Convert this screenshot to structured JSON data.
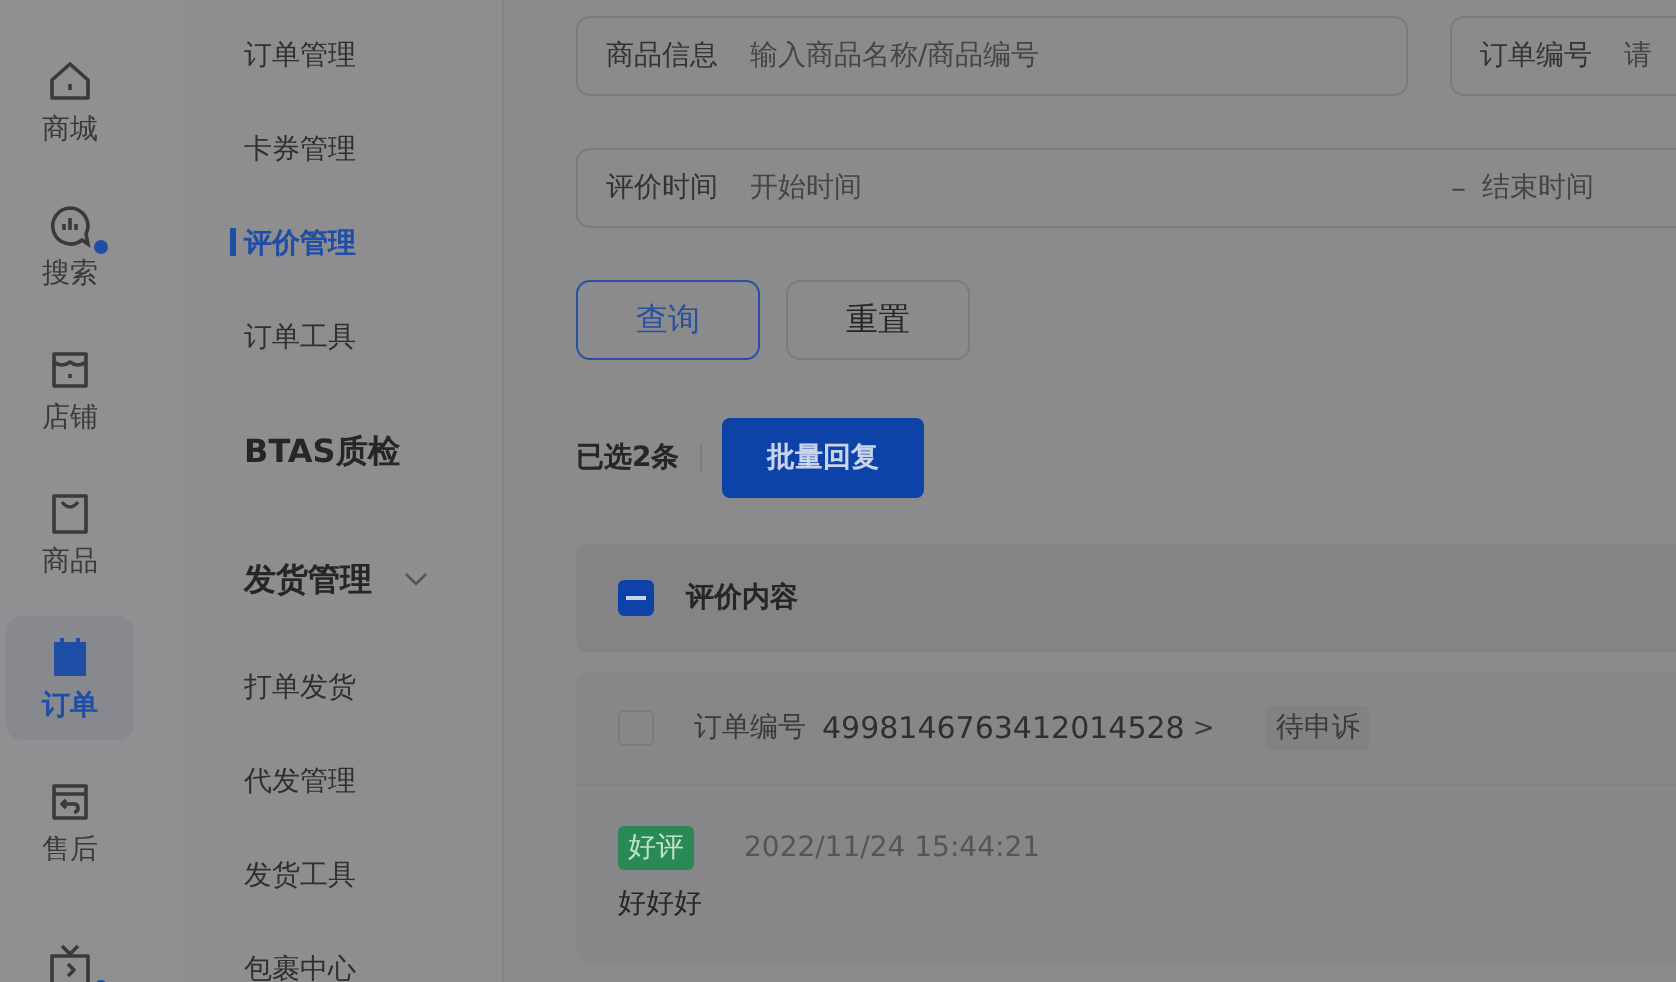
{
  "nav": [
    {
      "label": "商城",
      "selected": false,
      "dot": false
    },
    {
      "label": "搜索",
      "selected": false,
      "dot": true
    },
    {
      "label": "店铺",
      "selected": false,
      "dot": false
    },
    {
      "label": "商品",
      "selected": false,
      "dot": false
    },
    {
      "label": "订单",
      "selected": true,
      "dot": false
    },
    {
      "label": "售后",
      "selected": false,
      "dot": false
    },
    {
      "selected": false,
      "dot": true
    }
  ],
  "submenu": [
    {
      "kind": "item",
      "label": "订单管理",
      "selected": false
    },
    {
      "kind": "item",
      "label": "卡券管理",
      "selected": false
    },
    {
      "kind": "item",
      "label": "评价管理",
      "selected": true
    },
    {
      "kind": "item",
      "label": "订单工具",
      "selected": false
    },
    {
      "kind": "group",
      "label": "BTAS质检"
    },
    {
      "kind": "group",
      "label": "发货管理",
      "expanded": true
    },
    {
      "kind": "item",
      "label": "打单发货",
      "selected": false
    },
    {
      "kind": "item",
      "label": "代发管理",
      "selected": false
    },
    {
      "kind": "item",
      "label": "发货工具",
      "selected": false
    },
    {
      "kind": "item",
      "label": "包裹中心",
      "selected": false
    }
  ],
  "filters": {
    "product": {
      "label": "商品信息",
      "placeholder": "输入商品名称/商品编号"
    },
    "order": {
      "label": "订单编号",
      "placeholder": "请"
    },
    "time": {
      "label": "评价时间",
      "start_placeholder": "开始时间",
      "separator": "–",
      "end_placeholder": "结束时间"
    }
  },
  "buttons": {
    "query": "查询",
    "reset": "重置"
  },
  "selection": {
    "count_text": "已选2条",
    "batch_button": "批量回复"
  },
  "table": {
    "header": {
      "label": "评价内容",
      "indeterminate": true
    },
    "rows": [
      {
        "checked": false,
        "order_label": "订单编号",
        "order_no": "4998146763412014528",
        "chevron": ">",
        "status": "待申诉",
        "rating": "好评",
        "time": "2022/11/24 15:44:21",
        "content": "好好好"
      }
    ]
  }
}
